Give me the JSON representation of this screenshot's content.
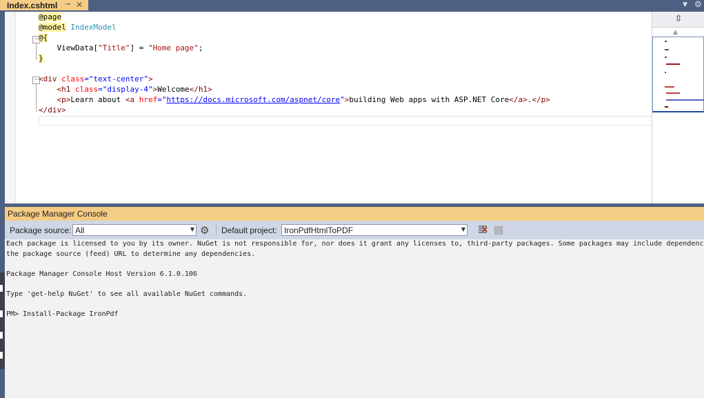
{
  "tab": {
    "title": "Index.cshtml",
    "pin_glyph": "⊸",
    "close_glyph": "✕",
    "icons": [
      "pin-icon",
      "close-icon",
      "dropdown-icon",
      "gear-icon"
    ]
  },
  "editor": {
    "lines": [
      [
        {
          "t": "@page",
          "c": "dir"
        }
      ],
      [
        {
          "t": "@model",
          "c": "dir"
        },
        {
          "t": " ",
          "c": "plain"
        },
        {
          "t": "IndexModel",
          "c": "type"
        }
      ],
      [
        {
          "t": "@{",
          "c": "dir"
        }
      ],
      [
        {
          "t": "    ViewData[",
          "c": "plain"
        },
        {
          "t": "\"Title\"",
          "c": "str"
        },
        {
          "t": "] = ",
          "c": "plain"
        },
        {
          "t": "\"Home page\"",
          "c": "str"
        },
        {
          "t": ";",
          "c": "plain"
        }
      ],
      [
        {
          "t": "}",
          "c": "dir"
        }
      ],
      [],
      [
        {
          "t": "<div ",
          "c": "tag"
        },
        {
          "t": "class",
          "c": "attr"
        },
        {
          "t": "=",
          "c": "val"
        },
        {
          "t": "\"text-center\"",
          "c": "val"
        },
        {
          "t": ">",
          "c": "tag"
        }
      ],
      [
        {
          "t": "    ",
          "c": "plain"
        },
        {
          "t": "<h1 ",
          "c": "tag"
        },
        {
          "t": "class",
          "c": "attr"
        },
        {
          "t": "=",
          "c": "val"
        },
        {
          "t": "\"display-4\"",
          "c": "val"
        },
        {
          "t": ">",
          "c": "tag"
        },
        {
          "t": "Welcome",
          "c": "plain"
        },
        {
          "t": "</h1>",
          "c": "tag"
        }
      ],
      [
        {
          "t": "    ",
          "c": "plain"
        },
        {
          "t": "<p>",
          "c": "tag"
        },
        {
          "t": "Learn about ",
          "c": "plain"
        },
        {
          "t": "<a ",
          "c": "tag"
        },
        {
          "t": "href",
          "c": "attr"
        },
        {
          "t": "=\"",
          "c": "val"
        },
        {
          "t": "https://docs.microsoft.com/aspnet/core",
          "c": "link"
        },
        {
          "t": "\"",
          "c": "val"
        },
        {
          "t": ">",
          "c": "tag"
        },
        {
          "t": "building Web apps with ASP.NET Core",
          "c": "plain"
        },
        {
          "t": "</a>",
          "c": "tag"
        },
        {
          "t": ".",
          "c": "plain"
        },
        {
          "t": "</p>",
          "c": "tag"
        }
      ],
      [
        {
          "t": "</div>",
          "c": "tag"
        }
      ]
    ],
    "colors": {
      "directive_highlight": "#fff4a3",
      "type": "#2b91af",
      "string": "#a31515",
      "tag": "#800000",
      "attribute": "#ff0000",
      "value": "#0000ff"
    }
  },
  "minimap": {
    "split_glyph": "⇳",
    "up_glyph": "▲",
    "icons": [
      "split-icon",
      "scroll-up-icon"
    ]
  },
  "pmc": {
    "title": "Package Manager Console",
    "package_source_label": "Package source:",
    "package_source_value": "All",
    "default_project_label": "Default project:",
    "default_project_value": "IronPdfHtmlToPDF",
    "gear_glyph": "⚙",
    "dropdown_glyph": "▼",
    "icons": [
      "settings-gear-icon",
      "clear-console-icon",
      "stop-icon"
    ],
    "output": [
      "Each package is licensed to you by its owner. NuGet is not responsible for, nor does it grant any licenses to, third-party packages. Some packages may include dependencies w",
      "the package source (feed) URL to determine any dependencies.",
      "",
      "Package Manager Console Host Version 6.1.0.106",
      "",
      "Type 'get-help NuGet' to see all available NuGet commands.",
      "",
      "PM> Install-Package IronPdf"
    ]
  },
  "colors": {
    "frame": "#4d6082",
    "tab_active": "#f5cc84",
    "toolbar": "#cfd6e5",
    "console_bg": "#f2f2f2"
  }
}
